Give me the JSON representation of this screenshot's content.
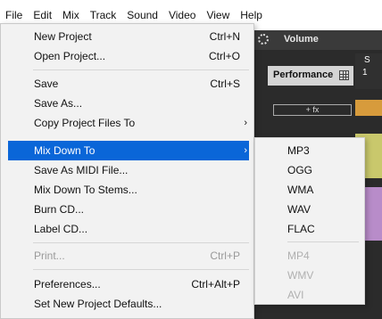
{
  "menubar": {
    "items": [
      "File",
      "Edit",
      "Mix",
      "Track",
      "Sound",
      "Video",
      "View",
      "Help"
    ]
  },
  "background": {
    "volume_label": "Volume",
    "performance_label": "Performance",
    "fx_label": "+ fx",
    "track_label": "S",
    "track_number": "1"
  },
  "file_menu": {
    "items": [
      {
        "label": "New Project",
        "shortcut": "Ctrl+N"
      },
      {
        "label": "Open Project...",
        "shortcut": "Ctrl+O"
      },
      {
        "label": "Save",
        "shortcut": "Ctrl+S"
      },
      {
        "label": "Save As...",
        "shortcut": ""
      },
      {
        "label": "Copy Project Files To",
        "arrow": "›"
      },
      {
        "label": "Mix Down To",
        "arrow": "›"
      },
      {
        "label": "Save As MIDI File...",
        "shortcut": ""
      },
      {
        "label": "Mix Down To Stems...",
        "shortcut": ""
      },
      {
        "label": "Burn CD...",
        "shortcut": ""
      },
      {
        "label": "Label CD...",
        "shortcut": ""
      },
      {
        "label": "Print...",
        "shortcut": "Ctrl+P"
      },
      {
        "label": "Preferences...",
        "shortcut": "Ctrl+Alt+P"
      },
      {
        "label": "Set New Project Defaults...",
        "shortcut": ""
      }
    ]
  },
  "mixdown_submenu": {
    "items": [
      "MP3",
      "OGG",
      "WMA",
      "WAV",
      "FLAC",
      "MP4",
      "WMV",
      "AVI"
    ]
  },
  "colors": {
    "highlight": "#0a66d8",
    "menu_bg": "#f2f2f2",
    "app_bg": "#2b2b2b"
  }
}
